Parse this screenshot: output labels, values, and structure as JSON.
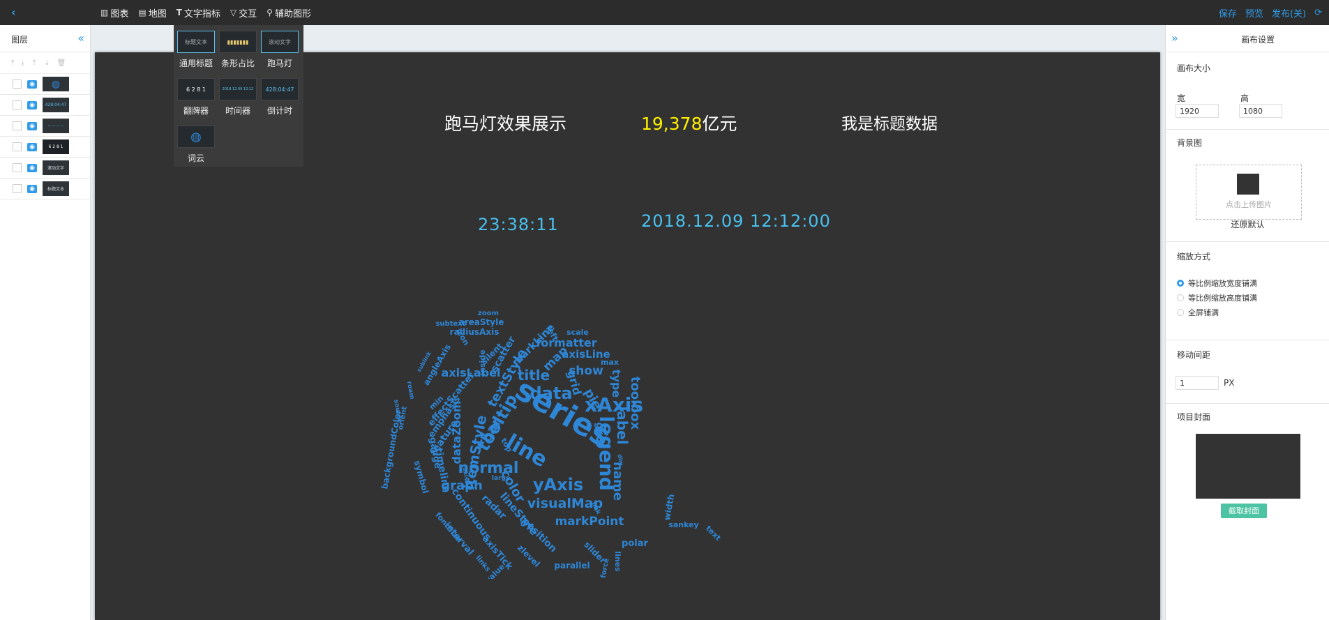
{
  "menu": [
    {
      "icon": "bar-chart-icon",
      "glyph": "▥",
      "label": "图表"
    },
    {
      "icon": "map-icon",
      "glyph": "▤",
      "label": "地图"
    },
    {
      "icon": "text-icon",
      "glyph": "T",
      "label": "文字指标"
    },
    {
      "icon": "interaction-icon",
      "glyph": "▽",
      "label": "交互"
    },
    {
      "icon": "shape-icon",
      "glyph": "⚲",
      "label": "辅助图形"
    }
  ],
  "top_actions": {
    "save": "保存",
    "preview": "预览",
    "publish": "发布(关)"
  },
  "layers": {
    "title": "图层",
    "rows": [
      {
        "thumb": ""
      },
      {
        "thumb": "428:04:47"
      },
      {
        "thumb": "-- -- -- --"
      },
      {
        "thumb": "6 2 8 1"
      },
      {
        "thumb": "滚动文字"
      },
      {
        "thumb": "标题文本"
      }
    ]
  },
  "dropdown": [
    {
      "thumb": "标题文本",
      "label": "通用标题"
    },
    {
      "thumb": "▮▮▮▮▮▮▮",
      "label": "条形占比"
    },
    {
      "thumb": "滚动文字",
      "label": "跑马灯"
    },
    {
      "thumb": "6 2 8 1",
      "label": "翻牌器"
    },
    {
      "thumb": "2018.12.09 12:12",
      "label": "时间器"
    },
    {
      "thumb": "428:04:47",
      "label": "倒计时"
    },
    {
      "thumb": "◍",
      "label": "词云"
    }
  ],
  "canvas": {
    "marquee": "跑马灯效果展示",
    "money_value": "19,378",
    "money_unit": "亿元",
    "title_data": "我是标题数据",
    "countdown": "23:38:11",
    "timer": "2018.12.09 12:12:00"
  },
  "word_cloud": {
    "color": "#2e86d6",
    "words": [
      "series",
      "xAxis",
      "legend",
      "line",
      "tooltip",
      "data",
      "yAxis",
      "normal",
      "itemStyle",
      "bar",
      "label",
      "name",
      "pie",
      "title",
      "textStyle",
      "visualMap",
      "markPoint",
      "graph",
      "color",
      "toolbox",
      "type",
      "show",
      "grid",
      "axisLabel",
      "dataZoom",
      "map",
      "formatter",
      "axisLine",
      "markLine",
      "scatter",
      "areaStyle",
      "radiusAxis",
      "subtext",
      "zoom",
      "left",
      "scale",
      "icon",
      "silent",
      "inside",
      "angleAxis",
      "effectScatter",
      "sublink",
      "emphasis",
      "min",
      "feature",
      "timeline",
      "gauge",
      "symbol",
      "backgroundColor",
      "orient",
      "roam",
      "source",
      "axis",
      "continuous",
      "radar",
      "lineStyle",
      "position",
      "interval",
      "axisTick",
      "zlevel",
      "links",
      "fontSize",
      "value",
      "parallel",
      "slider",
      "force",
      "lines",
      "polar",
      "width",
      "sankey",
      "text",
      "max",
      "top",
      "large",
      "geo",
      "link",
      "dim"
    ]
  },
  "settings": {
    "title": "画布设置",
    "canvas_size": "画布大小",
    "width_label": "宽",
    "height_label": "高",
    "width": "1920",
    "height": "1080",
    "bg_label": "背景图",
    "upload_hint": "点击上传图片",
    "restore": "还原默认",
    "scale_label": "缩放方式",
    "scale_options": [
      "等比例缩放宽度铺满",
      "等比例缩放高度铺满",
      "全屏铺满"
    ],
    "selected_scale": 0,
    "move_label": "移动间距",
    "move_value": "1",
    "move_unit": "PX",
    "cover_label": "项目封面",
    "cover_button": "截取封面"
  }
}
